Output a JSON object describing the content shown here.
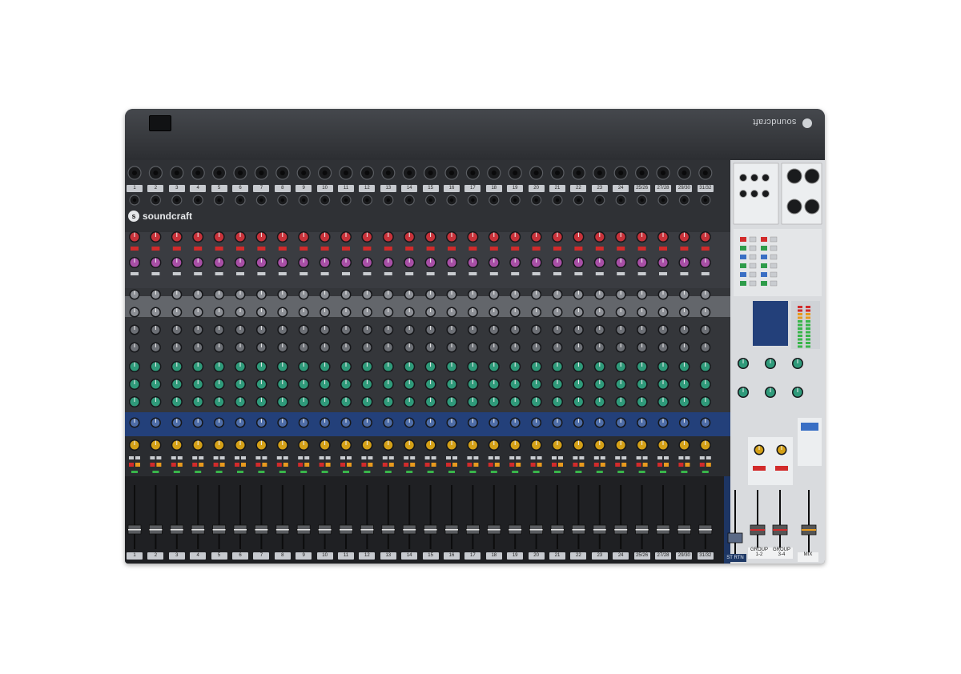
{
  "brand": {
    "name": "soundcraft",
    "logo_letter": "s"
  },
  "colors": {
    "chassis": "#2b2d31",
    "panel_light": "#d9dbde",
    "gain_knob": "#c8323a",
    "aux_knob": "#a84fa6",
    "eq_knob": "#2f9a7a",
    "pan_knob": "#d4a017",
    "blue_band": "#23407a",
    "button_red": "#d22b2b",
    "button_amber": "#e89a1e"
  },
  "channels": {
    "count": 28,
    "labels": [
      "1",
      "2",
      "3",
      "4",
      "5",
      "6",
      "7",
      "8",
      "9",
      "10",
      "11",
      "12",
      "13",
      "14",
      "15",
      "16",
      "17",
      "18",
      "19",
      "20",
      "21",
      "22",
      "23",
      "24",
      "25/26",
      "27/28",
      "29/30",
      "31/32"
    ]
  },
  "master": {
    "stereo_label": "ST RTN",
    "group1_label": "GROUP 1-2",
    "group2_label": "GROUP 3-4",
    "mix_label": "MIX"
  }
}
